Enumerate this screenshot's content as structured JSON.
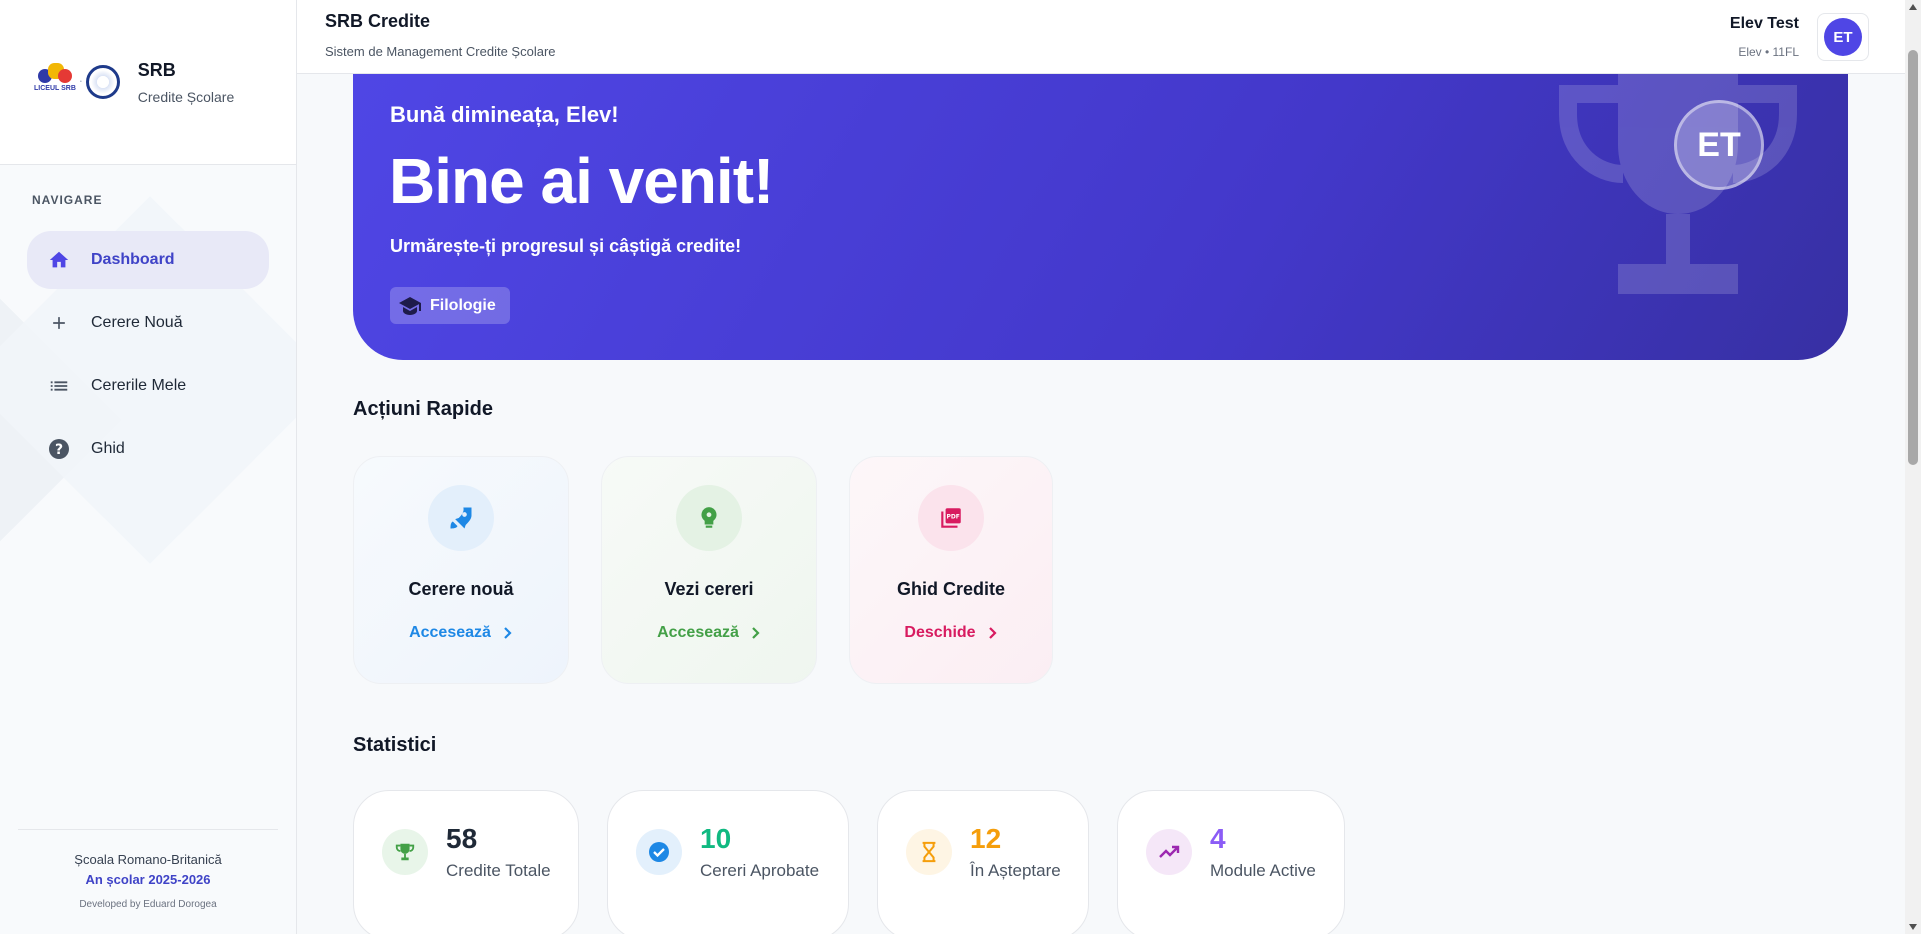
{
  "sidebar": {
    "brand_logo_text": "LICEUL SRB",
    "brand_title": "SRB",
    "brand_subtitle": "Credite Școlare",
    "nav_heading": "NAVIGARE",
    "items": [
      {
        "label": "Dashboard",
        "icon": "home-icon",
        "active": true
      },
      {
        "label": "Cerere Nouă",
        "icon": "plus-icon",
        "active": false
      },
      {
        "label": "Cererile Mele",
        "icon": "list-icon",
        "active": false
      },
      {
        "label": "Ghid",
        "icon": "help-icon",
        "active": false
      }
    ],
    "footer_school": "Școala Romano-Britanică",
    "footer_year": "An școlar 2025-2026",
    "footer_dev": "Developed by Eduard Dorogea"
  },
  "header": {
    "title": "SRB Credite",
    "subtitle": "Sistem de Management Credite Școlare",
    "user_name": "Elev Test",
    "user_meta": "Elev • 11FL",
    "avatar_initials": "ET"
  },
  "hero": {
    "greeting": "Bună dimineața, Elev!",
    "welcome": "Bine ai venit!",
    "tagline": "Urmărește-ți progresul și câștigă credite!",
    "profile_chip": "Filologie",
    "avatar_initials": "ET"
  },
  "quick_actions": {
    "title": "Acțiuni Rapide",
    "cards": [
      {
        "title": "Cerere nouă",
        "link": "Accesează",
        "icon": "rocket-icon",
        "color": "#1e88e5"
      },
      {
        "title": "Vezi cereri",
        "link": "Accesează",
        "icon": "bulb-gear-icon",
        "color": "#43a047"
      },
      {
        "title": "Ghid Credite",
        "link": "Deschide",
        "icon": "pdf-icon",
        "color": "#d81b60"
      }
    ]
  },
  "stats": {
    "title": "Statistici",
    "cards": [
      {
        "value": "58",
        "label": "Credite Totale",
        "icon": "trophy-icon",
        "color": "#1f2937",
        "icon_color": "#43a047"
      },
      {
        "value": "10",
        "label": "Cereri Aprobate",
        "icon": "check-circle-icon",
        "color": "#10b981",
        "icon_color": "#1e88e5"
      },
      {
        "value": "12",
        "label": "În Așteptare",
        "icon": "hourglass-icon",
        "color": "#f59e0b",
        "icon_color": "#f59e0b"
      },
      {
        "value": "4",
        "label": "Module Active",
        "icon": "trending-up-icon",
        "color": "#8b5cf6",
        "icon_color": "#9c27b0"
      }
    ]
  },
  "colors": {
    "accent": "#4f46e5",
    "hero_start": "#4f46e5",
    "hero_end": "#3730a3"
  }
}
